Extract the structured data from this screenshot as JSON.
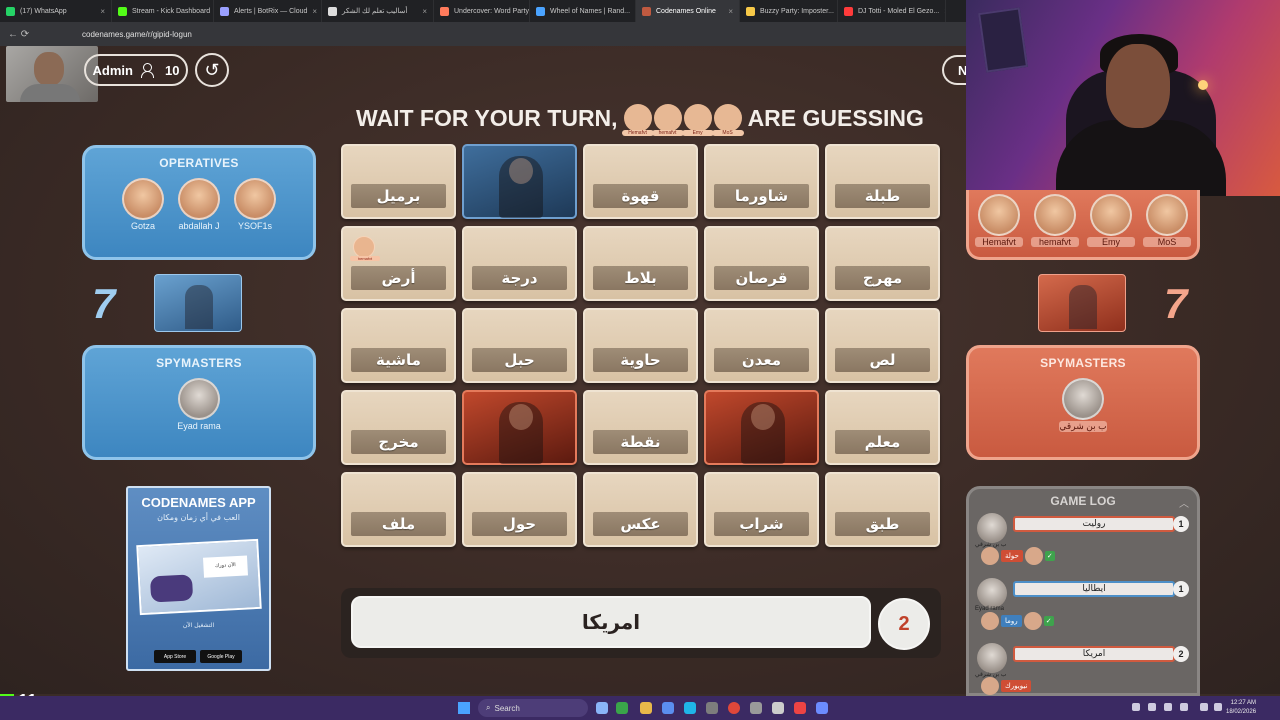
{
  "browser": {
    "tabs": [
      {
        "label": "(17) WhatsApp",
        "color": "#25d366",
        "active": false
      },
      {
        "label": "Stream - Kick Dashboard",
        "color": "#53fc18",
        "active": false
      },
      {
        "label": "Alerts | BotRix — Cloud",
        "color": "#9aa0ff",
        "active": false
      },
      {
        "label": "أساليب تعلم لك الشكر",
        "color": "#dddddd",
        "active": false
      },
      {
        "label": "Undercover: Word Party",
        "color": "#ff7b5c",
        "active": false
      },
      {
        "label": "Wheel of Names | Rand...",
        "color": "#4aa3ff",
        "active": false
      },
      {
        "label": "Codenames Online",
        "color": "#c05a40",
        "active": true
      },
      {
        "label": "Buzzy Party: Imposter...",
        "color": "#f7c948",
        "active": false
      },
      {
        "label": "DJ Totti - Moled El Gezo...",
        "color": "#ff3b3b",
        "active": false
      }
    ],
    "url": "codenames.game/r/gipid-logun",
    "nav": "←  ⟳"
  },
  "header": {
    "admin_label": "Admin",
    "user_count": "10",
    "reset_icon": "↺",
    "corner_label": "N",
    "headline_left": "WAIT FOR YOUR TURN,",
    "headline_right": "ARE GUESSING",
    "guessers": [
      "Hemafvt",
      "hemafvt",
      "Emy",
      "MoS"
    ]
  },
  "blue_team": {
    "operatives_title": "OPERATIVES",
    "operatives": [
      "Gotza",
      "abdallah J",
      "YSOF1s"
    ],
    "score": "7",
    "spymasters_title": "SPYMASTERS",
    "spymasters": [
      "Eyad rama"
    ],
    "color": "#3d86c0"
  },
  "red_team": {
    "operatives": [
      "Hemafvt",
      "hemafvt",
      "Emy",
      "MoS"
    ],
    "score": "7",
    "spymasters_title": "SPYMASTERS",
    "spymasters": [
      "ب بن شرقي"
    ],
    "color": "#c95a40"
  },
  "board": {
    "cards": [
      {
        "word": "برميل",
        "state": "hidden"
      },
      {
        "word": "",
        "state": "blue"
      },
      {
        "word": "قهوة",
        "state": "hidden"
      },
      {
        "word": "شاورما",
        "state": "hidden"
      },
      {
        "word": "طبلة",
        "state": "hidden"
      },
      {
        "word": "أرض",
        "state": "hidden",
        "tag": "hemafvt"
      },
      {
        "word": "درجة",
        "state": "hidden"
      },
      {
        "word": "بلاط",
        "state": "hidden"
      },
      {
        "word": "قرصان",
        "state": "hidden"
      },
      {
        "word": "مهرج",
        "state": "hidden"
      },
      {
        "word": "ماشية",
        "state": "hidden"
      },
      {
        "word": "حبل",
        "state": "hidden"
      },
      {
        "word": "حاوية",
        "state": "hidden"
      },
      {
        "word": "معدن",
        "state": "hidden"
      },
      {
        "word": "لص",
        "state": "hidden"
      },
      {
        "word": "مخرج",
        "state": "hidden"
      },
      {
        "word": "",
        "state": "red"
      },
      {
        "word": "نقطة",
        "state": "hidden"
      },
      {
        "word": "",
        "state": "red"
      },
      {
        "word": "معلم",
        "state": "hidden"
      },
      {
        "word": "ملف",
        "state": "hidden"
      },
      {
        "word": "حول",
        "state": "hidden"
      },
      {
        "word": "عكس",
        "state": "hidden"
      },
      {
        "word": "شراب",
        "state": "hidden"
      },
      {
        "word": "طبق",
        "state": "hidden"
      }
    ]
  },
  "clue": {
    "word": "امريكا",
    "number": "2"
  },
  "app_ad": {
    "title": "CODENAMES APP",
    "subtitle": "العب في أي زمان ومكان",
    "note": "الآن دورك",
    "cta": "التشغيل الآن",
    "store1": "App Store",
    "store2": "Google Play"
  },
  "game_log": {
    "title": "GAME LOG",
    "entries": [
      {
        "clue": "رولیت",
        "num": "1",
        "team": "red",
        "giver": "ب بن شرقي",
        "guesses": [
          {
            "word": "حولة",
            "team": "red",
            "check": false
          },
          {
            "word": "",
            "team": "",
            "check": true
          }
        ]
      },
      {
        "clue": "ايطاليا",
        "num": "1",
        "team": "blue",
        "giver": "Eyad rama",
        "guesses": [
          {
            "word": "روما",
            "team": "blue",
            "check": false
          },
          {
            "word": "",
            "team": "",
            "check": true
          }
        ]
      },
      {
        "clue": "امريكا",
        "num": "2",
        "team": "red",
        "giver": "ب بن شرقي",
        "guesses": [
          {
            "word": "نيويورك",
            "team": "red",
            "check": false
          }
        ]
      }
    ]
  },
  "stream": {
    "kick_count": "11"
  },
  "taskbar": {
    "search": "Search",
    "time": "12:27 AM",
    "date": "18/02/2026"
  }
}
